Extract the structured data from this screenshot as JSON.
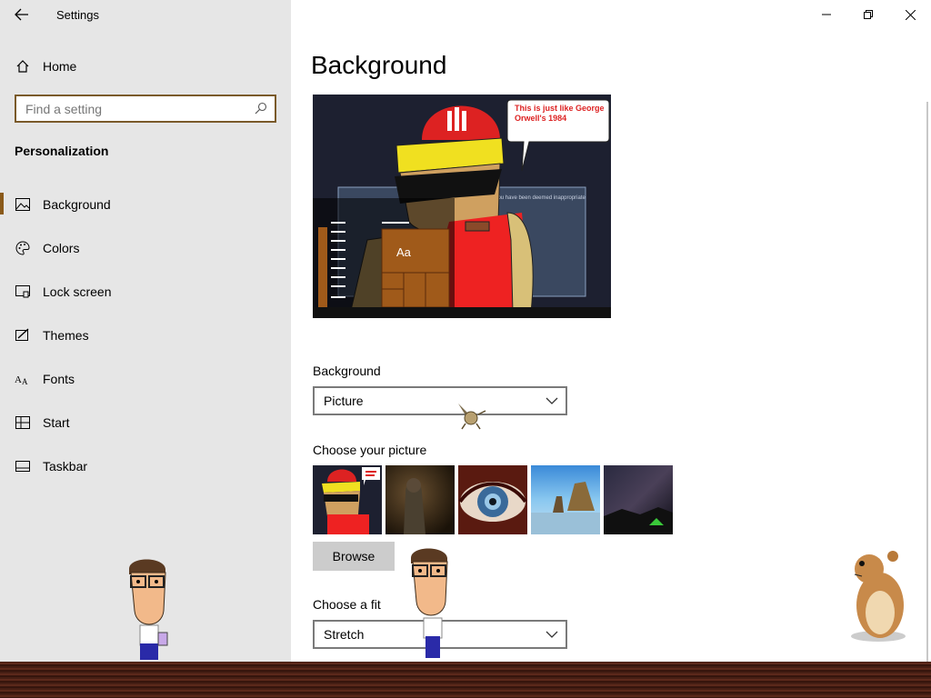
{
  "window": {
    "title": "Settings"
  },
  "sidebar": {
    "home_label": "Home",
    "search_placeholder": "Find a setting",
    "section_title": "Personalization",
    "items": [
      {
        "label": "Background",
        "icon": "picture-icon",
        "active": true
      },
      {
        "label": "Colors",
        "icon": "palette-icon"
      },
      {
        "label": "Lock screen",
        "icon": "lock-screen-icon"
      },
      {
        "label": "Themes",
        "icon": "themes-icon"
      },
      {
        "label": "Fonts",
        "icon": "fonts-icon"
      },
      {
        "label": "Start",
        "icon": "start-icon"
      },
      {
        "label": "Taskbar",
        "icon": "taskbar-icon"
      }
    ]
  },
  "main": {
    "title": "Background",
    "preview": {
      "speech_bubble": "This is just like George Orwell's 1984",
      "sample_text": "Aa",
      "banner_text": "You have been deemed inappropriate"
    },
    "background_label": "Background",
    "background_value": "Picture",
    "choose_picture_label": "Choose your picture",
    "thumbnails": [
      "cartoon-thumbnail",
      "soldier-thumbnail",
      "eye-thumbnail",
      "beach-thumbnail",
      "night-sky-thumbnail"
    ],
    "browse_label": "Browse",
    "fit_label": "Choose a fit",
    "fit_value": "Stretch"
  },
  "colors": {
    "accent": "#8a5a1a",
    "sidebar_bg": "#e6e6e6",
    "taskbar": "#3a1a10"
  }
}
